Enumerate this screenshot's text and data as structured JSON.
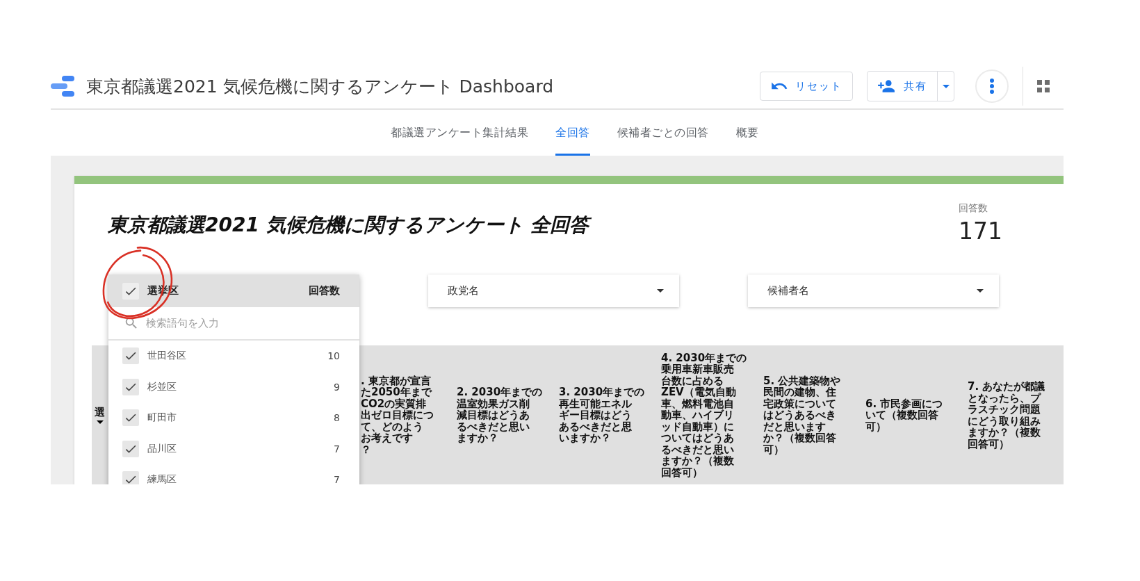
{
  "header": {
    "title": "東京都議選2021 気候危機に関するアンケート Dashboard",
    "buttons": [
      {
        "kind": "reset",
        "label": "リセット"
      },
      {
        "kind": "share",
        "label": "共有"
      }
    ]
  },
  "tabs": [
    {
      "label": "都議選アンケート集計結果",
      "selected": false
    },
    {
      "label": "全回答",
      "selected": true
    },
    {
      "label": "候補者ごとの回答",
      "selected": false
    },
    {
      "label": "概要",
      "selected": false
    }
  ],
  "report": {
    "title": "東京都議選2021 気候危機に関するアンケート 全回答",
    "count_label": "回答数",
    "count": "171"
  },
  "filters": [
    {
      "label": "選挙区",
      "expanded": true,
      "all_checked": true,
      "count_header": "回答数",
      "search_placeholder": "検索語句を入力",
      "options": [
        {
          "label": "世田谷区",
          "count": "10",
          "checked": true
        },
        {
          "label": "杉並区",
          "count": "9",
          "checked": true
        },
        {
          "label": "町田市",
          "count": "8",
          "checked": true
        },
        {
          "label": "品川区",
          "count": "7",
          "checked": true
        },
        {
          "label": "練馬区",
          "count": "7",
          "checked": true
        }
      ]
    },
    {
      "label": "政党名",
      "expanded": false
    },
    {
      "label": "候補者名",
      "expanded": false
    }
  ],
  "table": {
    "columns": [
      {
        "lines": [
          "選"
        ],
        "sorted": true
      },
      {
        "lines": [
          ". 東京都が宣言",
          "た2050年まで",
          "CO2の実質排",
          "出ゼロ目標につ",
          "て、どのよう",
          "お考えです",
          "？"
        ]
      },
      {
        "lines": [
          "2. 2030年までの",
          "温室効果ガス削",
          "減目標はどうあ",
          "るべきだと思い",
          "ますか？"
        ]
      },
      {
        "lines": [
          "3. 2030年までの",
          "再生可能エネル",
          "ギー目標はどう",
          "あるべきだと思",
          "いますか？"
        ]
      },
      {
        "lines": [
          "4. 2030年までの",
          "乗用車新車販売",
          "台数に占める",
          "ZEV（電気自動",
          "車、燃料電池自",
          "動車、ハイブリ",
          "ッド自動車）に",
          "ついてはどうあ",
          "るべきだと思い",
          "ますか？（複数",
          "回答可）"
        ]
      },
      {
        "lines": [
          "5. 公共建築物や",
          "民間の建物、住",
          "宅政策について",
          "はどうあるべき",
          "だと思います",
          "か？（複数回答",
          "可）"
        ]
      },
      {
        "lines": [
          "6. 市民参画につ",
          "いて（複数回答",
          "可）"
        ]
      },
      {
        "lines": [
          "7. あなたが都議",
          "となったら、プ",
          "ラスチック問題",
          "にどう取り組み",
          "ますか？（複数",
          "回答可）"
        ]
      }
    ]
  }
}
